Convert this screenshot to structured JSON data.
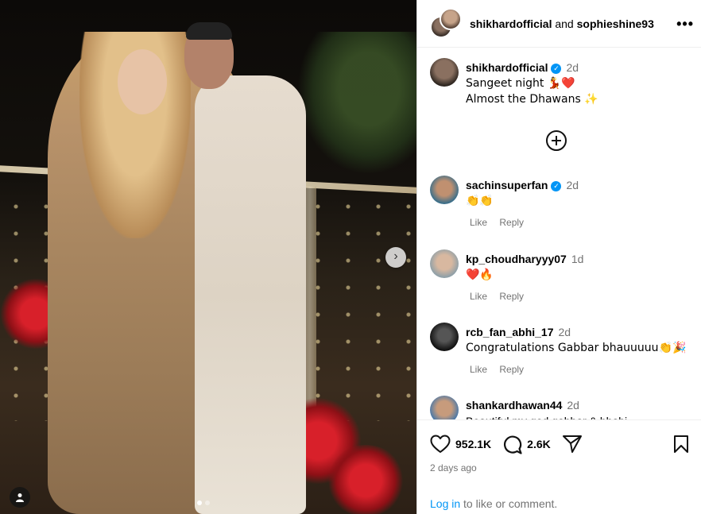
{
  "post": {
    "carousel": {
      "slide_count": 2,
      "active_slide": 1,
      "next_arrow": "›"
    }
  },
  "header": {
    "author": "shikhardofficial",
    "and": "and",
    "collaborator": "sophieshine93",
    "more": "•••"
  },
  "caption": {
    "username": "shikhardofficial",
    "time": "2d",
    "line1": "Sangeet night 💃❤️",
    "line2": "Almost the Dhawans ✨"
  },
  "comments": [
    {
      "username": "sachinsuperfan",
      "verified": true,
      "time": "2d",
      "text": "👏👏",
      "like": "Like",
      "reply": "Reply"
    },
    {
      "username": "kp_choudharyyy07",
      "verified": false,
      "time": "1d",
      "text": "❤️🔥",
      "like": "Like",
      "reply": "Reply"
    },
    {
      "username": "rcb_fan_abhi_17",
      "verified": false,
      "time": "2d",
      "text": "Congratulations Gabbar bhauuuuu👏🎉",
      "like": "Like",
      "reply": "Reply"
    },
    {
      "username": "shankardhawan44",
      "verified": false,
      "time": "2d",
      "text": "Beautiful my god gabbar & bhabi",
      "like": "",
      "reply": ""
    }
  ],
  "footer": {
    "likes": "952.1K",
    "comments": "2.6K",
    "posted": "2 days ago",
    "login_link": "Log in",
    "login_rest": " to like or comment."
  },
  "colors": {
    "link": "#0095f6",
    "verified": "#0095f6",
    "secondary_text": "#737373"
  },
  "icons": [
    "chevron-right-icon",
    "user-tag-icon",
    "more-icon",
    "add-circle-icon",
    "heart-icon",
    "comment-icon",
    "share-icon",
    "bookmark-icon",
    "verified-icon"
  ]
}
